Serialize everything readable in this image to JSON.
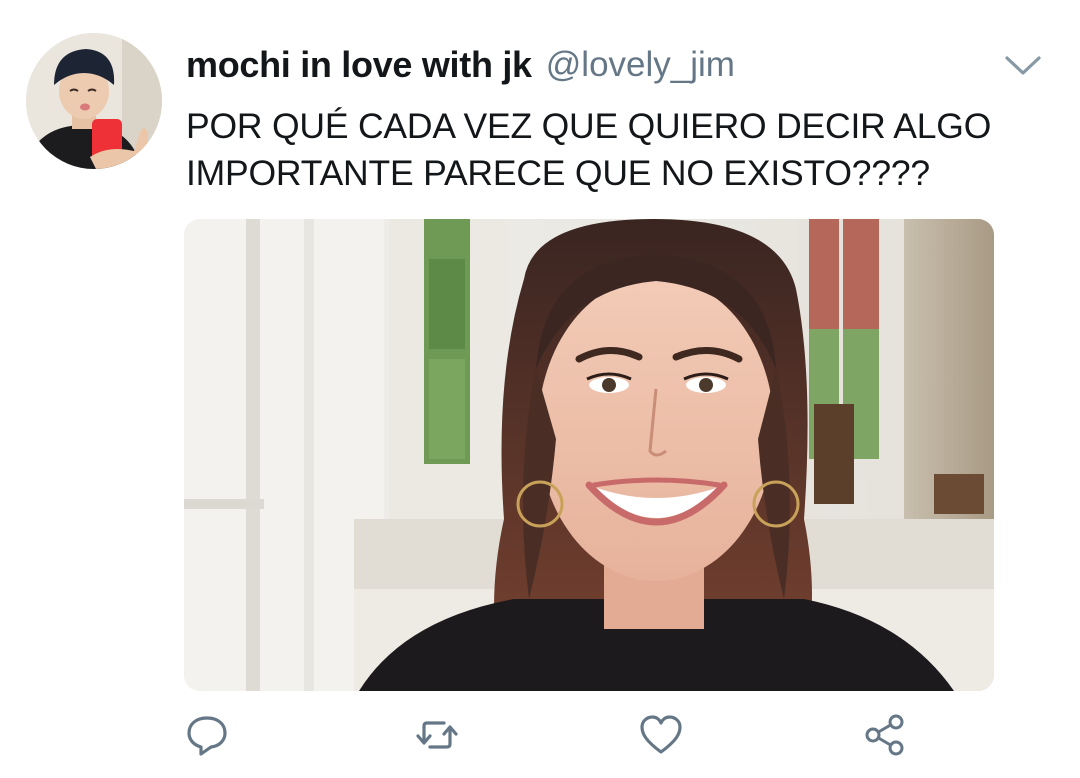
{
  "tweet": {
    "display_name": "mochi in love with jk",
    "handle": "@lovely_jim",
    "text": "POR QUÉ CADA VEZ QUE QUIERO DECIR ALGO\nIMPORTANTE PARECE QUE NO EXISTO????"
  },
  "icons": {
    "more": "chevron-down-icon",
    "reply": "reply-icon",
    "retweet": "retweet-icon",
    "like": "heart-icon",
    "share": "share-icon"
  },
  "colors": {
    "text": "#14171a",
    "secondary": "#657786",
    "icon": "#657786",
    "background": "#ffffff"
  }
}
